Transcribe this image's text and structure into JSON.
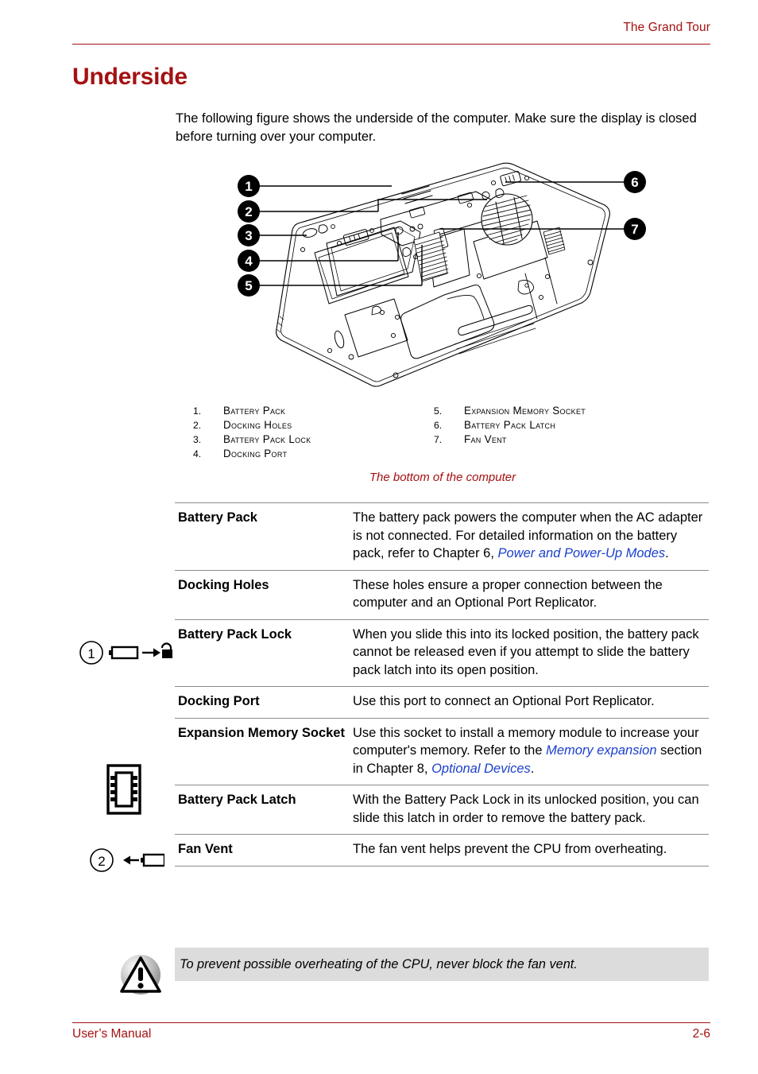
{
  "header": {
    "chapter_title": "The Grand Tour"
  },
  "section": {
    "title": "Underside",
    "intro": "The following figure shows the underside of the computer. Make sure the display is closed before turning over your computer."
  },
  "figure": {
    "caption": "The bottom of the computer",
    "callouts": [
      "1",
      "2",
      "3",
      "4",
      "5",
      "6",
      "7"
    ],
    "legend": {
      "left": [
        {
          "num": "1.",
          "label": "Battery Pack"
        },
        {
          "num": "2.",
          "label": "Docking Holes"
        },
        {
          "num": "3.",
          "label": "Battery Pack Lock"
        },
        {
          "num": "4.",
          "label": "Docking Port"
        }
      ],
      "right": [
        {
          "num": "5.",
          "label": "Expansion Memory Socket"
        },
        {
          "num": "6.",
          "label": "Battery Pack Latch"
        },
        {
          "num": "7.",
          "label": "Fan Vent"
        }
      ]
    }
  },
  "descriptions": [
    {
      "term": "Battery Pack",
      "text_before": "The battery pack powers the computer when the AC adapter is not connected. For detailed information on the battery pack, refer to Chapter 6, ",
      "xref": "Power and Power-Up Modes",
      "text_after": ".",
      "icon": null
    },
    {
      "term": "Docking Holes",
      "text_before": "These holes ensure a proper connection between the computer and an Optional Port Replicator.",
      "xref": "",
      "text_after": "",
      "icon": null
    },
    {
      "term": "Battery Pack Lock",
      "text_before": "When you slide this into its locked position, the battery pack cannot be released even if you attempt to slide the battery pack latch into its open position.",
      "xref": "",
      "text_after": "",
      "icon": "battery-lock-icon"
    },
    {
      "term": "Docking Port",
      "text_before": "Use this port to connect an Optional Port Replicator.",
      "xref": "",
      "text_after": "",
      "icon": null
    },
    {
      "term": "Expansion Memory Socket",
      "text_before": "Use this socket to install a memory module to increase your computer's memory. Refer to the ",
      "xref": "Memory expansion",
      "text_mid": " section in Chapter 8, ",
      "xref2": "Optional Devices",
      "text_after": ".",
      "icon": "memory-chip-icon"
    },
    {
      "term": "Battery Pack Latch",
      "text_before": "With the Battery Pack Lock in its unlocked position, you can slide this latch in order to remove the battery pack.",
      "xref": "",
      "text_after": "",
      "icon": "battery-latch-icon"
    },
    {
      "term": "Fan Vent",
      "text_before": "The fan vent helps prevent the CPU from overheating.",
      "xref": "",
      "text_after": "",
      "icon": null
    }
  ],
  "caution": {
    "icon": "caution-triangle-icon",
    "text": "To prevent possible overheating of the CPU, never block the fan vent."
  },
  "footer": {
    "left": "User’s Manual",
    "right": "2-6"
  },
  "margin_icons": {
    "lock_number": "1",
    "latch_number": "2"
  },
  "colors": {
    "accent_red": "#a51111",
    "xref_blue": "#1b3fcc",
    "rule_gray": "#8c8c8c",
    "caution_bg": "#dcdcdc"
  }
}
